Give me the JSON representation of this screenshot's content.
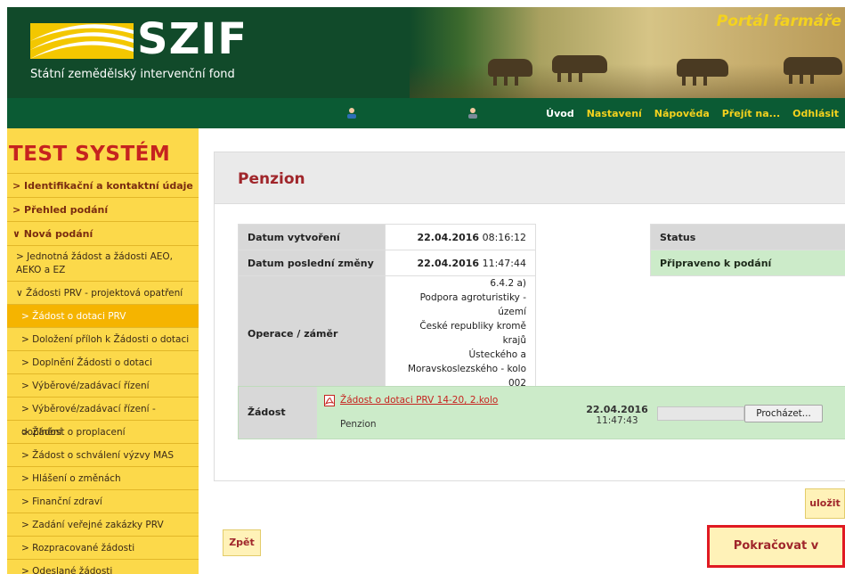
{
  "header": {
    "logo_text": "SZIF",
    "logo_subtitle": "Státní zemědělský intervenční fond",
    "portal_title": "Portál farmáře"
  },
  "nav": {
    "links": [
      "Úvod",
      "Nastavení",
      "Nápověda",
      "Přejít na...",
      "Odhlásit"
    ]
  },
  "sidebar": {
    "system_title": "TEST SYSTÉM",
    "items": {
      "identifikacni": "Identifikační a kontaktní údaje",
      "prehled": "Přehled podání",
      "nova": "Nová podání",
      "jednotna": "Jednotná žádost a žádosti AEO, AEKO a EZ",
      "prv": "Žádosti PRV - projektová opatření",
      "zadost_dotaci": "Žádost o dotaci PRV",
      "dolozeni": "Doložení příloh k Žádosti o dotaci",
      "doplneni": "Doplnění Žádosti o dotaci",
      "vyberove": "Výběrové/zadávací řízení",
      "vyberove_dopl": "Výběrové/zadávací řízení - doplnění",
      "proplaceni": "Žádost o proplacení",
      "mas": "Žádost o schválení výzvy MAS",
      "zmeny": "Hlášení o změnách",
      "financni": "Finanční zdraví",
      "verejne": "Zadání veřejné zakázky PRV",
      "rozpracovane": "Rozpracované žádosti",
      "odeslane": "Odeslané žádosti"
    }
  },
  "main": {
    "title": "Penzion",
    "info": {
      "created_label": "Datum vytvoření",
      "created_date": "22.04.2016",
      "created_time": "08:16:12",
      "changed_label": "Datum poslední změny",
      "changed_date": "22.04.2016",
      "changed_time": "11:47:44",
      "operation_label": "Operace / záměr",
      "operation_code": "6.4.2 a)",
      "operation_line1": "Podpora agroturistiky - území",
      "operation_line2": "České republiky kromě krajů",
      "operation_line3": "Ústeckého a",
      "operation_line4": "Moravskoslezského - kolo 002"
    },
    "status": {
      "label": "Status",
      "value": "Připraveno k podání"
    },
    "zadost": {
      "label": "Žádost",
      "link": "Žádost o dotaci PRV 14-20, 2.kolo",
      "name": "Penzion",
      "date": "22.04.2016",
      "time": "11:47:43",
      "browse_label": "Procházet..."
    }
  },
  "buttons": {
    "save": "uložit",
    "back": "Zpět",
    "continue": "Pokračovat v podání"
  }
}
